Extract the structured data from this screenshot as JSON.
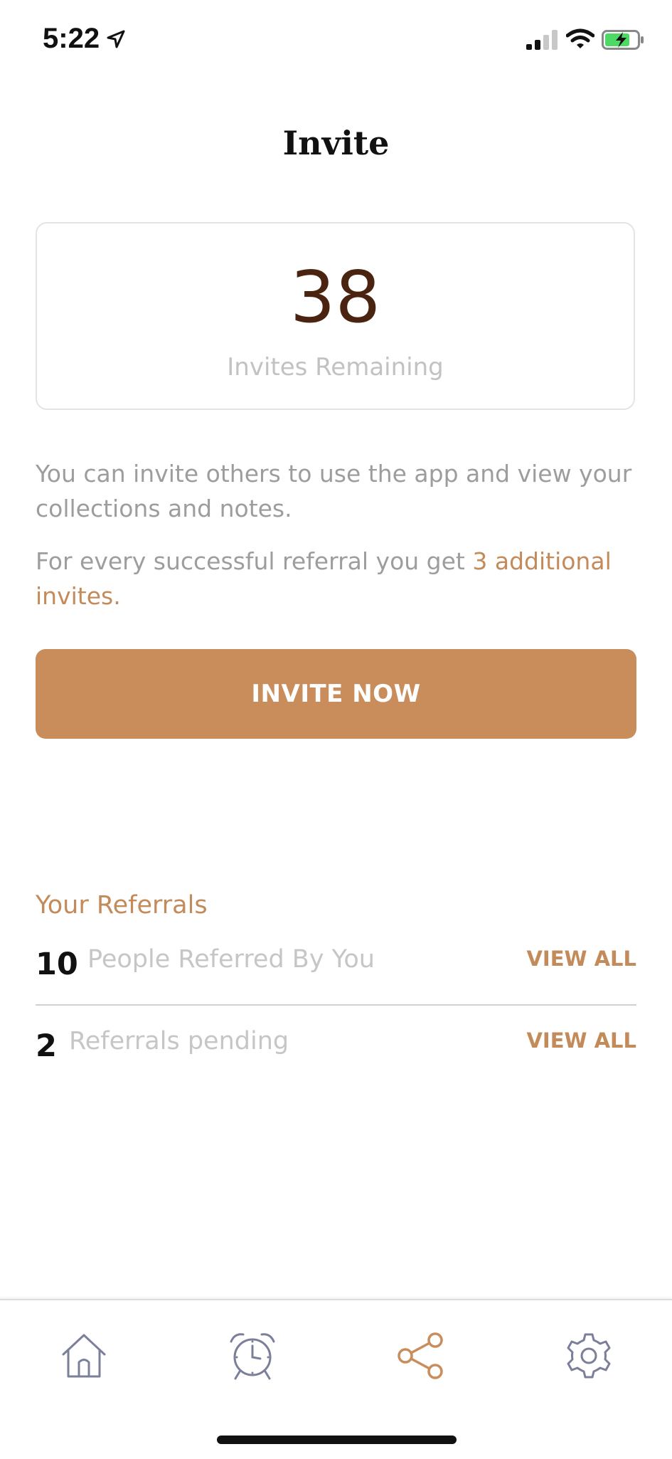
{
  "status_bar": {
    "time": "5:22"
  },
  "page": {
    "title": "Invite"
  },
  "invites": {
    "count": "38",
    "label": "Invites Remaining"
  },
  "description": {
    "para1": "You can invite others to use the app and view your collections and notes.",
    "para2_prefix": "For every successful referral you get ",
    "para2_highlight": "3 additional invites."
  },
  "invite_button": {
    "label": "INVITE NOW"
  },
  "referrals": {
    "heading": "Your Referrals",
    "rows": [
      {
        "count": "10",
        "label": "People Referred By You",
        "action": "VIEW ALL"
      },
      {
        "count": "2",
        "label": "Referrals pending",
        "action": "VIEW ALL"
      }
    ]
  },
  "tab_bar": {
    "tabs": [
      {
        "icon": "home-icon",
        "active": false
      },
      {
        "icon": "alarm-clock-icon",
        "active": false
      },
      {
        "icon": "share-icon",
        "active": true
      },
      {
        "icon": "gear-icon",
        "active": false
      }
    ]
  },
  "colors": {
    "accent": "#c98c5b",
    "accent_text": "#c48b5a",
    "count_text": "#4a2410",
    "muted_text": "#9d9d9d",
    "inactive_icon": "#7b7f99"
  }
}
